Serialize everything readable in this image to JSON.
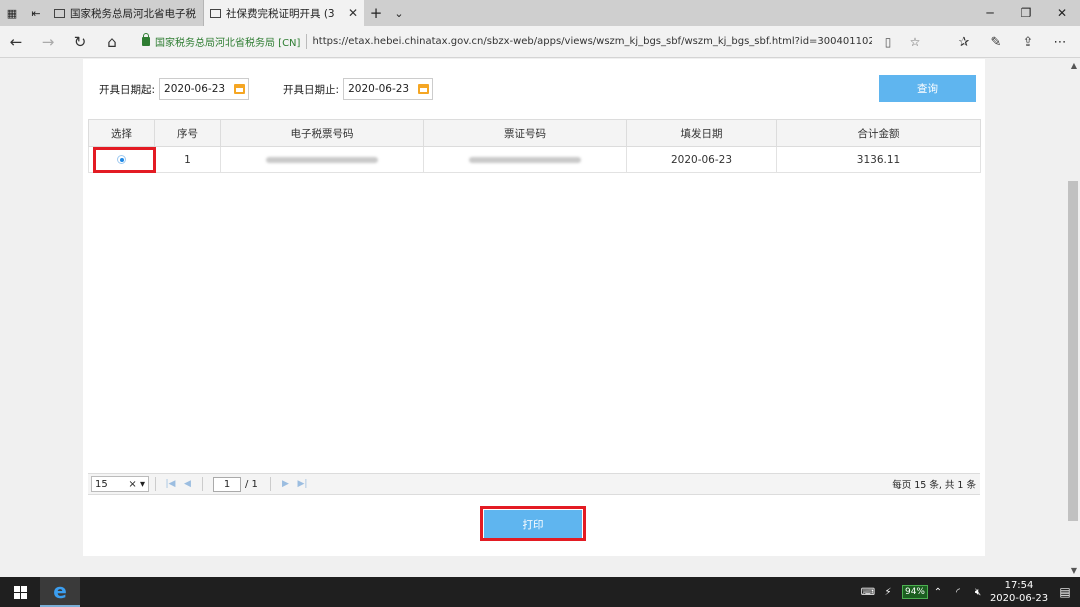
{
  "browser": {
    "tabs": [
      {
        "title": "国家税务总局河北省电子税",
        "active": false
      },
      {
        "title": "社保费完税证明开具 (3",
        "active": true
      }
    ],
    "site_identity": "国家税务总局河北省税务局 [CN]",
    "url": "https://etax.hebei.chinatax.gov.cn/sbzx-web/apps/views/wszm_kj_bgs_sbf/wszm_kj_bgs_sbf.html?id=300401102&code=30040110&"
  },
  "filters": {
    "start_label": "开具日期起:",
    "start_date": "2020-06-23",
    "end_label": "开具日期止:",
    "end_date": "2020-06-23",
    "query_button": "查询"
  },
  "table": {
    "columns": [
      "选择",
      "序号",
      "电子税票号码",
      "票证号码",
      "填发日期",
      "合计金额"
    ],
    "rows": [
      {
        "selected": true,
        "index": "1",
        "ticket_no": "",
        "cert_no": "",
        "date": "2020-06-23",
        "amount": "3136.11"
      }
    ]
  },
  "pager": {
    "page_size": "15",
    "page": "1",
    "total_pages": "/ 1",
    "summary": "每页 15 条, 共 1 条"
  },
  "actions": {
    "print_button": "打印"
  },
  "taskbar": {
    "battery": "94%",
    "time": "17:54",
    "date": "2020-06-23"
  },
  "colors": {
    "accent": "#5fb5ef",
    "highlight": "#e31b23",
    "secure": "#2e7d32"
  }
}
